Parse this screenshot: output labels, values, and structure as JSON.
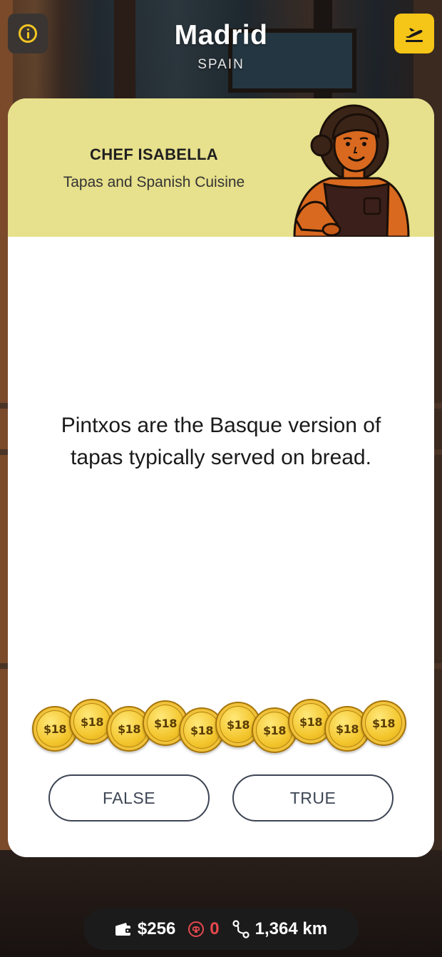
{
  "header": {
    "city": "Madrid",
    "country": "SPAIN",
    "info_icon": "info-circle-icon",
    "travel_icon": "airplane-departure-icon"
  },
  "card": {
    "chef_name": "CHEF ISABELLA",
    "chef_specialty": "Tapas and Spanish Cuisine",
    "header_color": "#e7e08c",
    "question": "Pintxos are the Basque version of tapas typically served on bread."
  },
  "coins": {
    "label": "$18",
    "count": 10,
    "color": "#f3c52c"
  },
  "answers": {
    "false_label": "FALSE",
    "true_label": "TRUE"
  },
  "status": {
    "money": "$256",
    "money_icon": "wallet-icon",
    "skulls": "0",
    "skull_icon": "skull-icon",
    "skull_color": "#e5484d",
    "distance": "1,364 km",
    "distance_icon": "route-icon"
  }
}
